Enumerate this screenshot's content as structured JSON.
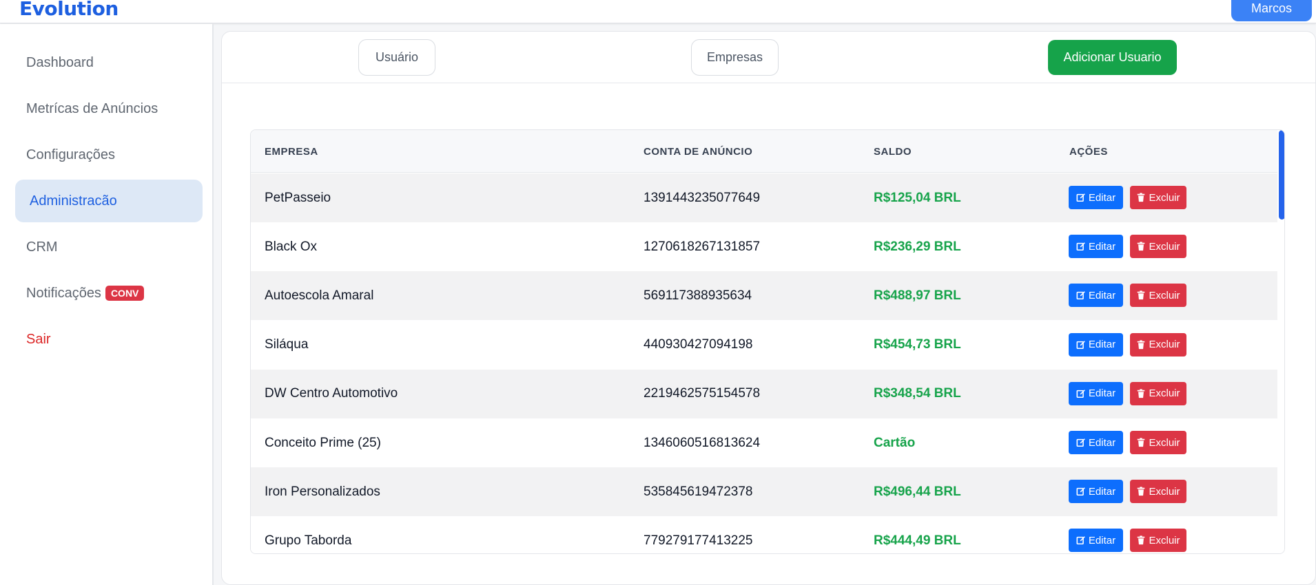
{
  "app": {
    "logo": "Evolution",
    "user_name": "Marcos"
  },
  "sidebar": {
    "items": [
      {
        "label": "Dashboard"
      },
      {
        "label": "Metrícas de Anúncios"
      },
      {
        "label": "Configurações"
      },
      {
        "label": "Administracão",
        "active": true
      },
      {
        "label": "CRM"
      },
      {
        "label": "Notificações",
        "badge": "CONV"
      },
      {
        "label": "Sair"
      }
    ]
  },
  "tabs": {
    "users": "Usuário",
    "companies": "Empresas",
    "add_user": "Adicionar Usuario"
  },
  "table": {
    "headers": [
      "EMPRESA",
      "CONTA DE ANÚNCIO",
      "SALDO",
      "AÇÕES"
    ],
    "edit_label": "Editar",
    "delete_label": "Excluir",
    "rows": [
      {
        "empresa": "PetPasseio",
        "conta": "1391443235077649",
        "saldo": "R$125,04 BRL"
      },
      {
        "empresa": "Black Ox",
        "conta": "1270618267131857",
        "saldo": "R$236,29 BRL"
      },
      {
        "empresa": "Autoescola Amaral",
        "conta": "569117388935634",
        "saldo": "R$488,97 BRL"
      },
      {
        "empresa": "Siláqua",
        "conta": "440930427094198",
        "saldo": "R$454,73 BRL"
      },
      {
        "empresa": "DW Centro Automotivo",
        "conta": "2219462575154578",
        "saldo": "R$348,54 BRL"
      },
      {
        "empresa": "Conceito Prime (25)",
        "conta": "1346060516813624",
        "saldo": "Cartão"
      },
      {
        "empresa": "Iron Personalizados",
        "conta": "535845619472378",
        "saldo": "R$496,44 BRL"
      },
      {
        "empresa": "Grupo Taborda",
        "conta": "779279177413225",
        "saldo": "R$444,49 BRL"
      }
    ]
  },
  "colors": {
    "brand": "#1d5fe0",
    "success": "#16a34a",
    "danger": "#dc3545",
    "primary": "#0d6efd"
  }
}
